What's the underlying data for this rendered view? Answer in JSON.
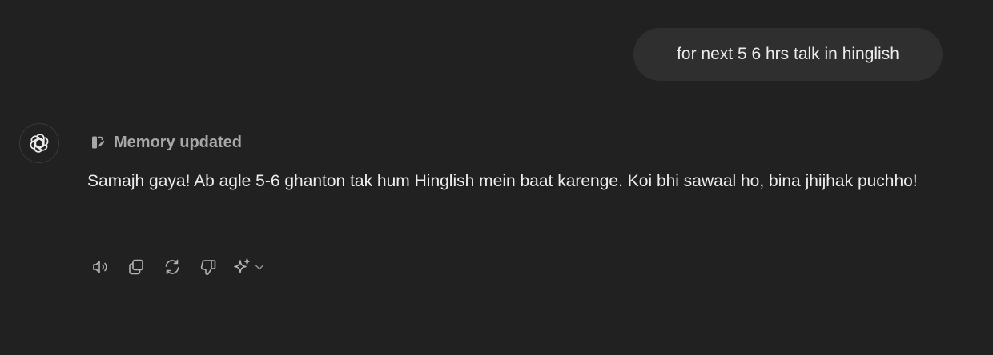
{
  "conversation": {
    "user_message": "for next 5 6 hrs talk in hinglish",
    "memory_status": "Memory updated",
    "assistant_message": "Samajh gaya! Ab agle 5-6 ghanton tak hum Hinglish mein baat karenge. Koi bhi sawaal ho, bina jhijhak puchho!"
  },
  "icons": {
    "avatar": "openai-logo-icon",
    "memory": "memory-edit-icon",
    "actions": [
      "speaker-icon",
      "copy-icon",
      "regenerate-icon",
      "thumbs-down-icon",
      "sparkle-icon",
      "chevron-down-icon"
    ]
  },
  "colors": {
    "background": "#212121",
    "user_bubble": "#2f2f2f",
    "text": "#ececec",
    "muted": "#a8a8a8"
  }
}
